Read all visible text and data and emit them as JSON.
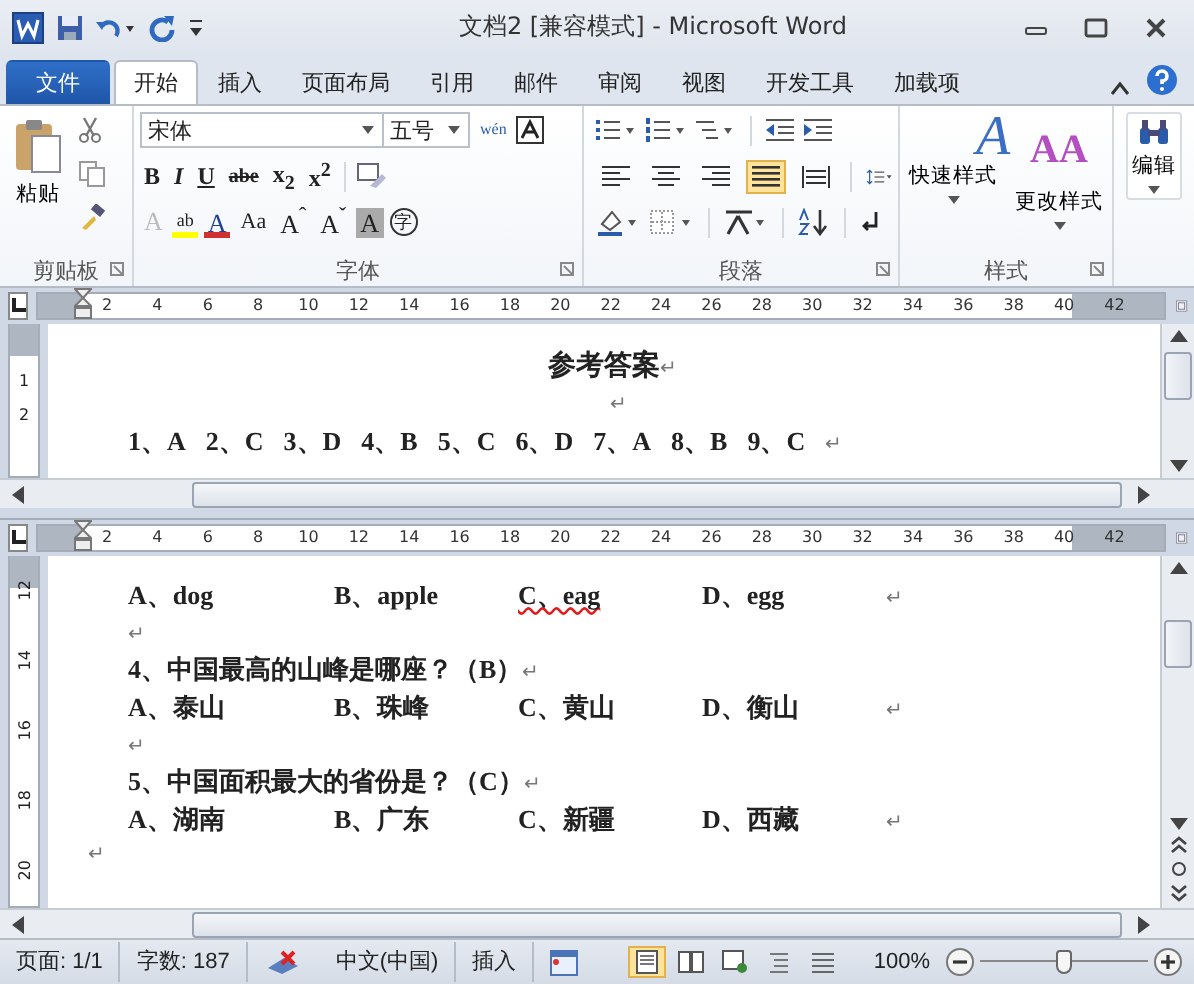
{
  "window": {
    "title": "文档2 [兼容模式]  -  Microsoft Word"
  },
  "tabs": [
    {
      "label": "文件",
      "kind": "file",
      "selected": false
    },
    {
      "label": "开始",
      "kind": "tab",
      "selected": true
    },
    {
      "label": "插入",
      "kind": "tab",
      "selected": false
    },
    {
      "label": "页面布局",
      "kind": "tab",
      "selected": false
    },
    {
      "label": "引用",
      "kind": "tab",
      "selected": false
    },
    {
      "label": "邮件",
      "kind": "tab",
      "selected": false
    },
    {
      "label": "审阅",
      "kind": "tab",
      "selected": false
    },
    {
      "label": "视图",
      "kind": "tab",
      "selected": false
    },
    {
      "label": "开发工具",
      "kind": "tab",
      "selected": false
    },
    {
      "label": "加载项",
      "kind": "tab",
      "selected": false
    }
  ],
  "ribbon": {
    "clipboard": {
      "paste": "粘贴",
      "label": "剪贴板"
    },
    "font": {
      "font_name": "宋体",
      "font_size": "五号",
      "phonetic": "wén",
      "label": "字体",
      "row2": [
        "B",
        "I",
        "U",
        "abe",
        "x$_{2}$",
        "x$^{2}$"
      ],
      "row3": [
        "A",
        "ab",
        "A",
        "Aa",
        "A$^{ˆ}$",
        "A$^{ˇ}$",
        "A",
        "字"
      ]
    },
    "paragraph": {
      "label": "段落",
      "alignments": [
        {
          "selected": false
        },
        {
          "selected": false
        },
        {
          "selected": false
        },
        {
          "selected": true
        },
        {
          "selected": false
        }
      ]
    },
    "styles": {
      "label": "样式",
      "quick_glyph": "A",
      "quick": "快速样式",
      "change_glyph": "AA",
      "change": "更改样式"
    },
    "editing": {
      "label": "编辑"
    }
  },
  "top_pane": {
    "ruler": [
      "2",
      "4",
      "6",
      "8",
      "10",
      "12",
      "14",
      "16",
      "18",
      "20",
      "22",
      "24",
      "26",
      "28",
      "30",
      "32",
      "34",
      "36",
      "38",
      "40",
      "42"
    ],
    "vruler": [
      "1",
      "2"
    ],
    "heading": {
      "text": "参考答案",
      "mark": "↵"
    },
    "blank": {
      "mark": "↵"
    },
    "answers": [
      "1、A",
      "2、C",
      "3、D",
      "4、B",
      "5、C",
      "6、D",
      "7、A",
      "8、B",
      "9、C"
    ],
    "answers_mark": "↵"
  },
  "bottom_pane": {
    "ruler": [
      "2",
      "4",
      "6",
      "8",
      "10",
      "12",
      "14",
      "16",
      "18",
      "20",
      "22",
      "24",
      "26",
      "28",
      "30",
      "32",
      "34",
      "36",
      "38",
      "40",
      "42"
    ],
    "vruler": [
      "12",
      "14",
      "16",
      "18",
      "20"
    ],
    "questions": [
      {
        "options": [
          {
            "text": "A、dog",
            "spell_error": false
          },
          {
            "text": "B、apple",
            "spell_error": false
          },
          {
            "text": "C、eag",
            "spell_error": true
          },
          {
            "text": "D、egg",
            "spell_error": false
          }
        ],
        "mark": "↵"
      },
      {
        "question": "4、中国最高的山峰是哪座？（B）",
        "question_mark": "↵",
        "options": [
          {
            "text": "A、泰山",
            "spell_error": false
          },
          {
            "text": "B、珠峰",
            "spell_error": false
          },
          {
            "text": "C、黄山",
            "spell_error": false
          },
          {
            "text": "D、衡山",
            "spell_error": false
          }
        ],
        "mark": "↵"
      },
      {
        "question": "5、中国面积最大的省份是？（C）",
        "question_mark": "↵",
        "options": [
          {
            "text": "A、湖南",
            "spell_error": false
          },
          {
            "text": "B、广东",
            "spell_error": false
          },
          {
            "text": "C、新疆",
            "spell_error": false
          },
          {
            "text": "D、西藏",
            "spell_error": false
          }
        ],
        "mark": "↵"
      }
    ],
    "blank_marks": [
      "↵",
      "↵"
    ],
    "end_mark": "↵"
  },
  "status_bar": {
    "page": "页面: 1/1",
    "words": "字数: 187",
    "language": "中文(中国)",
    "mode": "插入",
    "views": [
      {
        "selected": true
      },
      {
        "selected": false
      },
      {
        "selected": false
      },
      {
        "selected": false
      },
      {
        "selected": false
      }
    ],
    "zoom": "100%",
    "zoom_slider": {
      "level": 0.5
    }
  }
}
